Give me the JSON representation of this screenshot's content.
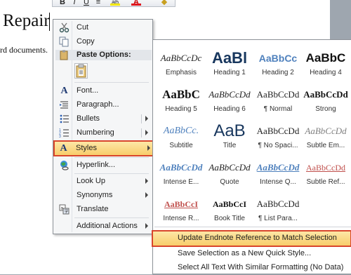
{
  "document": {
    "title": "Repair",
    "text": "rd documents."
  },
  "mini_toolbar": {
    "buttons": [
      {
        "glyph": "B",
        "icon": "bold-icon"
      },
      {
        "glyph": "I",
        "icon": "italic-icon"
      },
      {
        "glyph": "U",
        "icon": "underline-icon"
      },
      {
        "glyph": "≡",
        "icon": "center-align-icon"
      },
      {
        "glyph": "ab",
        "icon": "highlight-icon"
      },
      {
        "glyph": "A",
        "icon": "font-color-icon"
      },
      {
        "glyph": "◆",
        "icon": "format-painter-icon"
      }
    ]
  },
  "context_menu": {
    "cut": "Cut",
    "copy": "Copy",
    "paste_header": "Paste Options:",
    "font": "Font...",
    "paragraph": "Paragraph...",
    "bullets": "Bullets",
    "numbering": "Numbering",
    "styles": "Styles",
    "hyperlink": "Hyperlink...",
    "look_up": "Look Up",
    "synonyms": "Synonyms",
    "translate": "Translate",
    "additional_actions": "Additional Actions"
  },
  "styles_gallery": {
    "items": [
      {
        "preview": "AaBbCcDc",
        "name": "Emphasis"
      },
      {
        "preview": "AaBl",
        "name": "Heading 1"
      },
      {
        "preview": "AaBbCc",
        "name": "Heading 2"
      },
      {
        "preview": "AaBbC",
        "name": "Heading 4"
      },
      {
        "preview": "AaBbC",
        "name": "Heading 5"
      },
      {
        "preview": "AaBbCcDd",
        "name": "Heading 6"
      },
      {
        "preview": "AaBbCcDd",
        "name": "¶ Normal"
      },
      {
        "preview": "AaBbCcDd",
        "name": "Strong"
      },
      {
        "preview": "AaBbCc.",
        "name": "Subtitle"
      },
      {
        "preview": "AaB",
        "name": "Title"
      },
      {
        "preview": "AaBbCcDd",
        "name": "¶ No Spaci..."
      },
      {
        "preview": "AaBbCcDd",
        "name": "Subtle Em..."
      },
      {
        "preview": "AaBbCcDd",
        "name": "Intense E..."
      },
      {
        "preview": "AaBbCcDd",
        "name": "Quote"
      },
      {
        "preview": "AaBbCcDd",
        "name": "Intense Q..."
      },
      {
        "preview": "AaBbCcDd",
        "name": "Subtle Ref..."
      },
      {
        "preview": "AaBbCcI",
        "name": "Intense R..."
      },
      {
        "preview": "AaBbCcI",
        "name": "Book Title"
      },
      {
        "preview": "AaBbCcDd",
        "name": "¶ List Para..."
      }
    ],
    "actions": {
      "update_endnote": "Update Endnote Reference to Match Selection",
      "save_selection": "Save Selection as a New Quick Style...",
      "select_all": "Select All Text With Similar Formatting (No Data)"
    }
  },
  "colors": {
    "highlight": "#f8cd6b",
    "highlight_outline": "#d9452c",
    "heading_blue": "#4f81bd"
  }
}
